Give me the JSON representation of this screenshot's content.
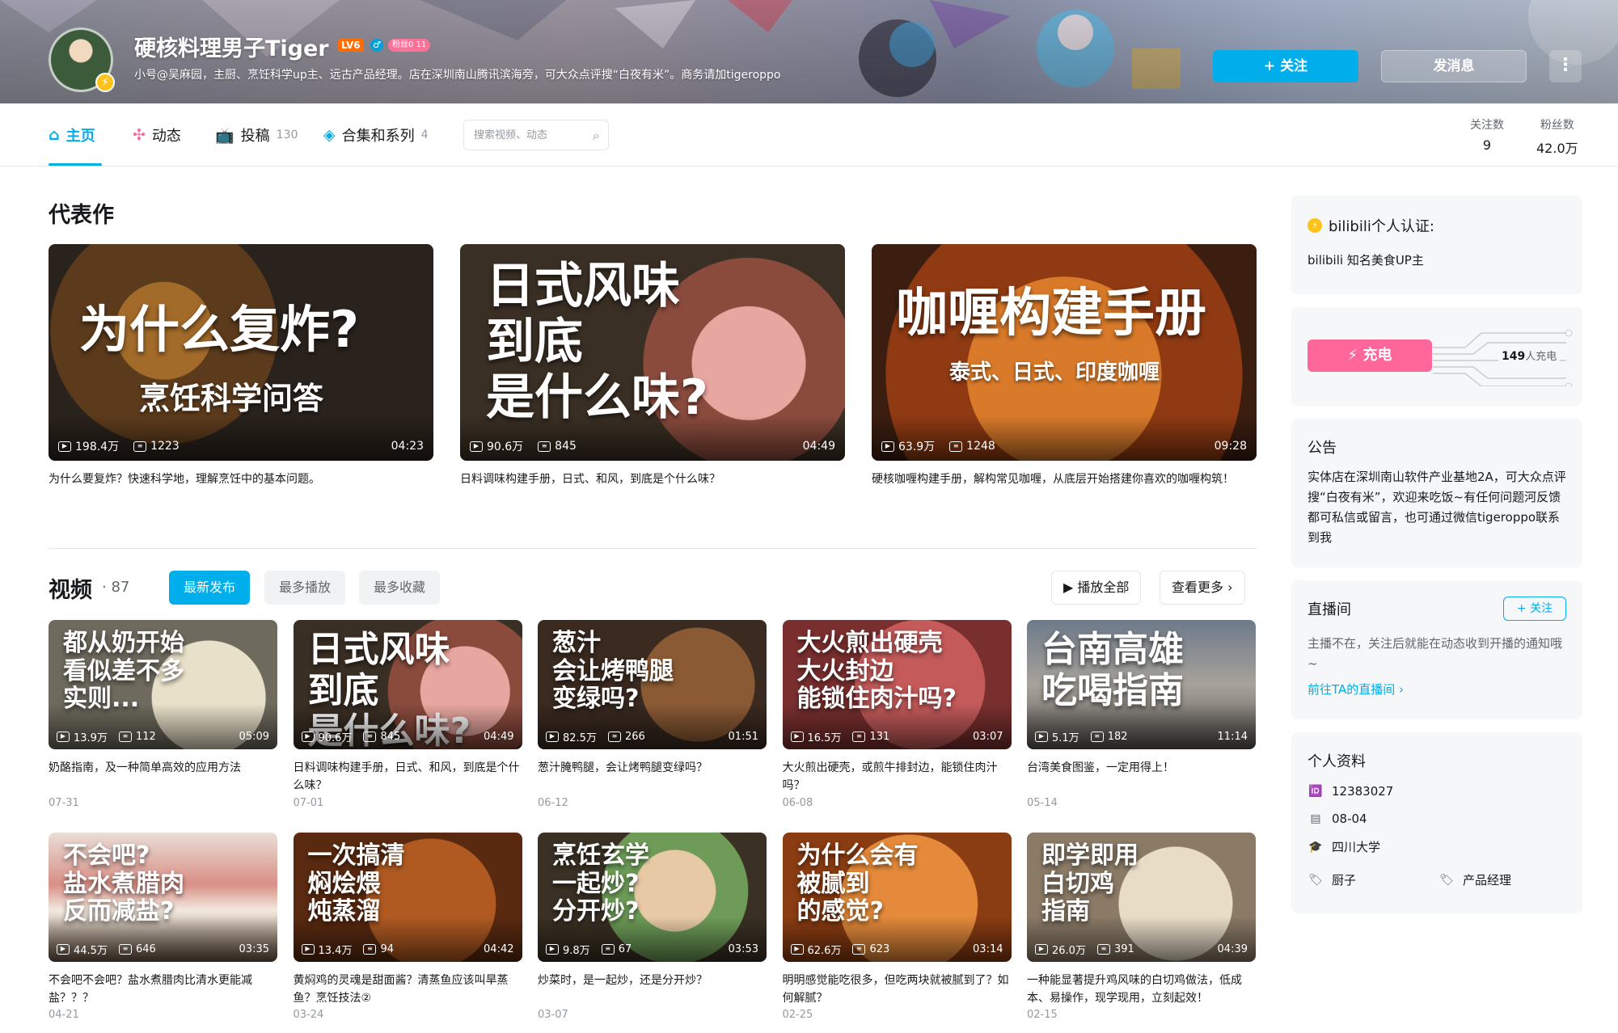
{
  "profile": {
    "name": "硬核料理男子Tiger",
    "level": "LV6",
    "gender_icon": "male-icon",
    "medal": "粉丝0 11",
    "sign": "小号@吴麻园，主厨、烹饪科学up主、远古产品经理。店在深圳南山腾讯滨海旁，可大众点评搜“白夜有米”。商务请加tigeroppo",
    "follow_label": "+ 关注",
    "message_label": "发消息",
    "more_label": "⋮"
  },
  "nav": {
    "tabs": [
      {
        "label": "主页",
        "icon": "home-icon",
        "count": ""
      },
      {
        "label": "动态",
        "icon": "pinwheel-icon",
        "count": ""
      },
      {
        "label": "投稿",
        "icon": "tv-icon",
        "count": "130"
      },
      {
        "label": "合集和系列",
        "icon": "stack-icon",
        "count": "4"
      }
    ],
    "search_placeholder": "搜索视频、动态",
    "stats": [
      {
        "label": "关注数",
        "value": "9"
      },
      {
        "label": "粉丝数",
        "value": "42.0万"
      }
    ]
  },
  "masterpiece": {
    "title": "代表作",
    "items": [
      {
        "t1": "为什么复炸?",
        "t2": "烹饪科学问答",
        "views": "198.4万",
        "danmaku": "1223",
        "duration": "04:23",
        "title": "为什么要复炸？快速科学地，理解烹饪中的基本问题。"
      },
      {
        "t1": "日式风味\n到底\n是什么味?",
        "t2": "",
        "views": "90.6万",
        "danmaku": "845",
        "duration": "04:49",
        "title": "日料调味构建手册，日式、和风，到底是个什么味？"
      },
      {
        "t1": "咖喱构建手册",
        "t2": "泰式、日式、印度咖喱",
        "views": "63.9万",
        "danmaku": "1248",
        "duration": "09:28",
        "title": "硬核咖喱构建手册，解构常见咖喱，从底层开始搭建你喜欢的咖喱构筑！"
      }
    ]
  },
  "videos": {
    "title": "视频",
    "count": "87",
    "tabs": [
      "最新发布",
      "最多播放",
      "最多收藏"
    ],
    "play_all": "▶ 播放全部",
    "see_more": "查看更多 ›",
    "items": [
      {
        "t1": "都从奶开始\n看似差不多\n实则...",
        "views": "13.9万",
        "danmaku": "112",
        "duration": "05:09",
        "title": "奶酪指南，及一种简单高效的应用方法",
        "date": "07-31"
      },
      {
        "t1": "日式风味\n到底\n是什么味?",
        "views": "90.6万",
        "danmaku": "845",
        "duration": "04:49",
        "title": "日料调味构建手册，日式、和风，到底是个什么味？",
        "date": "07-01"
      },
      {
        "t1": "葱汁\n会让烤鸭腿\n变绿吗?",
        "views": "82.5万",
        "danmaku": "266",
        "duration": "01:51",
        "title": "葱汁腌鸭腿，会让烤鸭腿变绿吗？",
        "date": "06-12"
      },
      {
        "t1": "大火煎出硬壳\n大火封边\n能锁住肉汁吗?",
        "views": "16.5万",
        "danmaku": "131",
        "duration": "03:07",
        "title": "大火煎出硬壳，或煎牛排封边，能锁住肉汁吗？",
        "date": "06-08"
      },
      {
        "t1": "台南高雄\n吃喝指南",
        "views": "5.1万",
        "danmaku": "182",
        "duration": "11:14",
        "title": "台湾美食图鉴，一定用得上！",
        "date": "05-14"
      },
      {
        "t1": "不会吧?\n盐水煮腊肉\n反而减盐?",
        "views": "44.5万",
        "danmaku": "646",
        "duration": "03:35",
        "title": "不会吧不会吧？盐水煮腊肉比清水更能减盐？？？",
        "date": "04-21"
      },
      {
        "t1": "一次搞清\n焖烩煨\n炖蒸溜",
        "views": "13.4万",
        "danmaku": "94",
        "duration": "04:42",
        "title": "黄焖鸡的灵魂是甜面酱？清蒸鱼应该叫旱蒸鱼？烹饪技法②",
        "date": "03-24"
      },
      {
        "t1": "烹饪玄学\n一起炒?\n分开炒?",
        "views": "9.8万",
        "danmaku": "67",
        "duration": "03:53",
        "title": "炒菜时，是一起炒，还是分开炒？",
        "date": "03-07"
      },
      {
        "t1": "为什么会有\n被腻到\n的感觉?",
        "views": "62.6万",
        "danmaku": "623",
        "duration": "03:14",
        "title": "明明感觉能吃很多，但吃两块就被腻到了？如何解腻？",
        "date": "02-25"
      },
      {
        "t1": "即学即用\n白切鸡\n指南",
        "views": "26.0万",
        "danmaku": "391",
        "duration": "04:39",
        "title": "一种能显著提升鸡风味的白切鸡做法，低成本、易操作，现学现用，立刻起效！",
        "date": "02-15"
      }
    ]
  },
  "sidebar": {
    "cert": {
      "title": "bilibili个人认证:",
      "text": "bilibili 知名美食UP主"
    },
    "charge": {
      "button": "充电",
      "count": "149",
      "suffix": "人充电"
    },
    "notice": {
      "title": "公告",
      "text": "实体店在深圳南山软件产业基地2A，可大众点评搜“白夜有米”，欢迎来吃饭~有任何问题河反馈都可私信或留言，也可通过微信tigeroppo联系到我"
    },
    "live": {
      "title": "直播间",
      "follow": "+ 关注",
      "text": "主播不在，关注后就能在动态收到开播的通知哦~",
      "link": "前往TA的直播间 ›"
    },
    "info": {
      "title": "个人资料",
      "uid": "12383027",
      "birthday": "08-04",
      "school": "四川大学",
      "tag1": "厨子",
      "tag2": "产品经理"
    }
  },
  "colors": {
    "accent": "#00aeec",
    "pink": "#ff6699"
  }
}
